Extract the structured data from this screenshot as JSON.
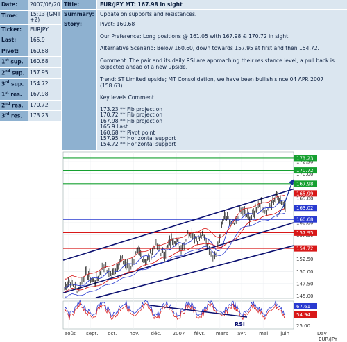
{
  "info": {
    "date": {
      "label": "Date:",
      "value": "2007/06/20"
    },
    "time": {
      "label": "Time:",
      "value": "15:13 (GMT +2)"
    },
    "ticker": {
      "label": "Ticker:",
      "value": "EURJPY"
    },
    "last": {
      "label": "Last:",
      "value": "165.9"
    },
    "pivot": {
      "label": "Pivot:",
      "value": "160.68"
    },
    "sup1": {
      "label_num": "1",
      "label_sfx": "st",
      "label_rest": " sup.",
      "value": "160.68"
    },
    "sup2": {
      "label_num": "2",
      "label_sfx": "nd",
      "label_rest": " sup.",
      "value": "157.95"
    },
    "sup3": {
      "label_num": "3",
      "label_sfx": "rd",
      "label_rest": " sup.",
      "value": "154.72"
    },
    "res1": {
      "label_num": "1",
      "label_sfx": "st",
      "label_rest": " res.",
      "value": "167.98"
    },
    "res2": {
      "label_num": "2",
      "label_sfx": "nd",
      "label_rest": " res.",
      "value": "170.72"
    },
    "res3": {
      "label_num": "3",
      "label_sfx": "rd",
      "label_rest": " res.",
      "value": "173.23"
    }
  },
  "panel": {
    "title_label": "Title:",
    "title": "EUR/JPY MT: 167.98 in sight",
    "summary_label": "Summary:",
    "summary": "Update on supports and resistances.",
    "story_label": "Story:",
    "story": {
      "pivot": "Pivot: 160.68",
      "preference": "Our Preference: Long positions @ 161.05 with 167.98 & 170.72 in sight.",
      "alternative": "Alternative Scenario: Below 160.60, down towards 157.95 at first and then 154.72.",
      "comment": "Comment: The pair and its daily RSI are approaching their resistance level, a pull back is expected ahead of a new upside.",
      "trend": "Trend: ST Limited upside; MT Consolidation, we have been bullish since 04 APR 2007 (158.63).",
      "levels_header": "Key levels Comment",
      "levels": [
        "173.23 ** Fib projection",
        "170.72 ** Fib projection",
        "167.98 ** Fib projection",
        "165.9 Last",
        "160.68 ** Pivot point",
        "157.95 ** Horizontal support",
        "154.72 ** Horizontal support"
      ]
    }
  },
  "chart_data": {
    "type": "line",
    "title": "",
    "y_axis_ticks": [
      "172.50",
      "170.00",
      "165.00",
      "160.00",
      "157.50",
      "152.50",
      "150.00",
      "147.50",
      "145.00"
    ],
    "ylim": [
      144.5,
      174.5
    ],
    "x_axis_labels": [
      "août",
      "sept.",
      "oct.",
      "nov.",
      "déc.",
      "2007",
      "févr.",
      "mars",
      "avr.",
      "mai",
      "juin",
      "Day"
    ],
    "x_axis_sublabel": "EUR/JPY",
    "price_tags": [
      {
        "value": "173.23",
        "color": "#16a030"
      },
      {
        "value": "170.72",
        "color": "#16a030"
      },
      {
        "value": "167.98",
        "color": "#16a030"
      },
      {
        "value": "165.99",
        "color": "#d81818"
      },
      {
        "value": "163.02",
        "color": "#2a3bd0"
      },
      {
        "value": "160.68",
        "color": "#2a3bd0"
      },
      {
        "value": "157.95",
        "color": "#d81818"
      },
      {
        "value": "154.72",
        "color": "#d81818"
      }
    ],
    "levels": [
      {
        "value": 173.23,
        "color": "#16a030",
        "label": "173.23"
      },
      {
        "value": 170.72,
        "color": "#16a030",
        "label": "170.72"
      },
      {
        "value": 167.98,
        "color": "#16a030",
        "label": "167.98"
      },
      {
        "value": 160.68,
        "color": "#2a3bd0",
        "label": "160.68"
      },
      {
        "value": 157.95,
        "color": "#d81818",
        "label": "157.95"
      },
      {
        "value": 154.72,
        "color": "#d81818",
        "label": "154.72"
      }
    ],
    "rsi": {
      "label": "RSI",
      "ticks": [
        "67.61",
        "54.94",
        "25.00"
      ],
      "tick_colors": [
        "#2a3bd0",
        "#d81818",
        "#000000"
      ]
    },
    "colors": {
      "price": "#000000",
      "ma_red": "#d81818",
      "ma_blue": "#2a3bd0",
      "channel": "#0b1070",
      "arrow": "#1530a0"
    }
  }
}
